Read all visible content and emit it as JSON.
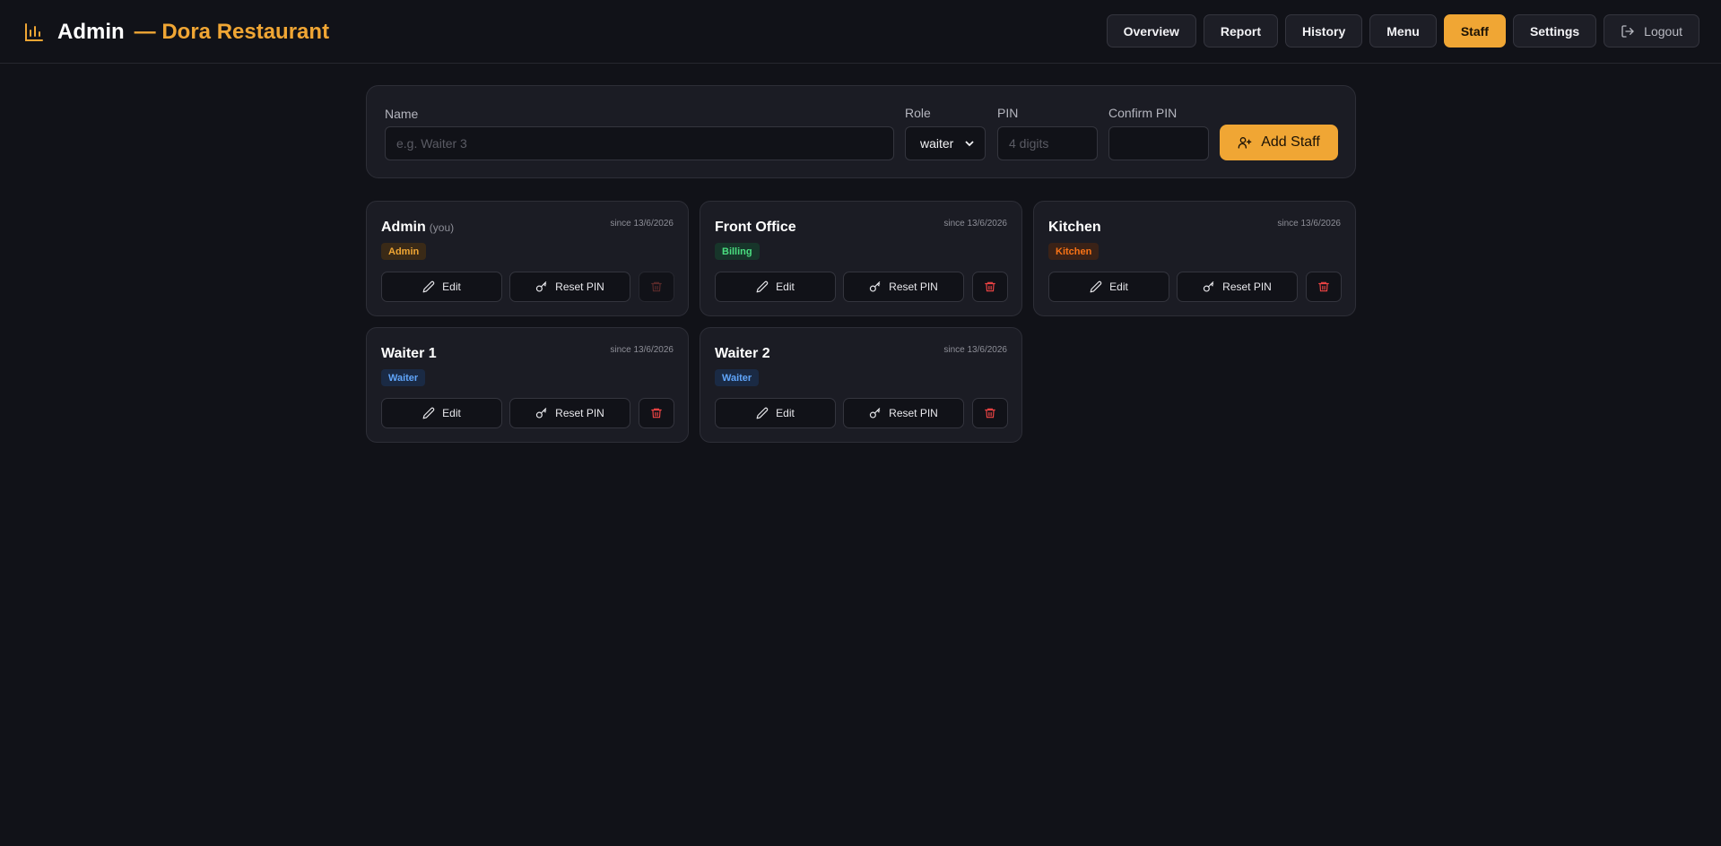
{
  "header": {
    "title": "Admin",
    "subtitle": "— Dora Restaurant",
    "brand_color": "#f0a634",
    "nav": [
      {
        "label": "Overview",
        "active": false
      },
      {
        "label": "Report",
        "active": false
      },
      {
        "label": "History",
        "active": false
      },
      {
        "label": "Menu",
        "active": false
      },
      {
        "label": "Staff",
        "active": true
      },
      {
        "label": "Settings",
        "active": false
      }
    ],
    "logout_label": "Logout"
  },
  "form": {
    "name_label": "Name",
    "name_placeholder": "e.g. Waiter 3",
    "role_label": "Role",
    "role_value": "waiter",
    "pin_label": "PIN",
    "pin_placeholder": "4 digits",
    "confirm_label": "Confirm PIN",
    "add_label": "Add Staff"
  },
  "staff": [
    {
      "name": "Admin",
      "you": "(you)",
      "since": "since 13/6/2026",
      "role": "Admin",
      "badge_bg": "#3a2a17",
      "badge_fg": "#f0a634",
      "delete_disabled": true
    },
    {
      "name": "Front Office",
      "you": "",
      "since": "since 13/6/2026",
      "role": "Billing",
      "badge_bg": "#17352a",
      "badge_fg": "#4ade80",
      "delete_disabled": false
    },
    {
      "name": "Kitchen",
      "you": "",
      "since": "since 13/6/2026",
      "role": "Kitchen",
      "badge_bg": "#3a2217",
      "badge_fg": "#f97316",
      "delete_disabled": false
    },
    {
      "name": "Waiter 1",
      "you": "",
      "since": "since 13/6/2026",
      "role": "Waiter",
      "badge_bg": "#1a2a44",
      "badge_fg": "#60a5fa",
      "delete_disabled": false
    },
    {
      "name": "Waiter 2",
      "you": "",
      "since": "since 13/6/2026",
      "role": "Waiter",
      "badge_bg": "#1a2a44",
      "badge_fg": "#60a5fa",
      "delete_disabled": false
    }
  ],
  "card_actions": {
    "edit_label": "Edit",
    "reset_label": "Reset PIN"
  },
  "icons": {
    "brand": "bar-chart-icon",
    "logout": "logout-icon",
    "add": "user-plus-icon",
    "edit": "pencil-icon",
    "reset": "key-icon",
    "delete": "trash-icon"
  }
}
